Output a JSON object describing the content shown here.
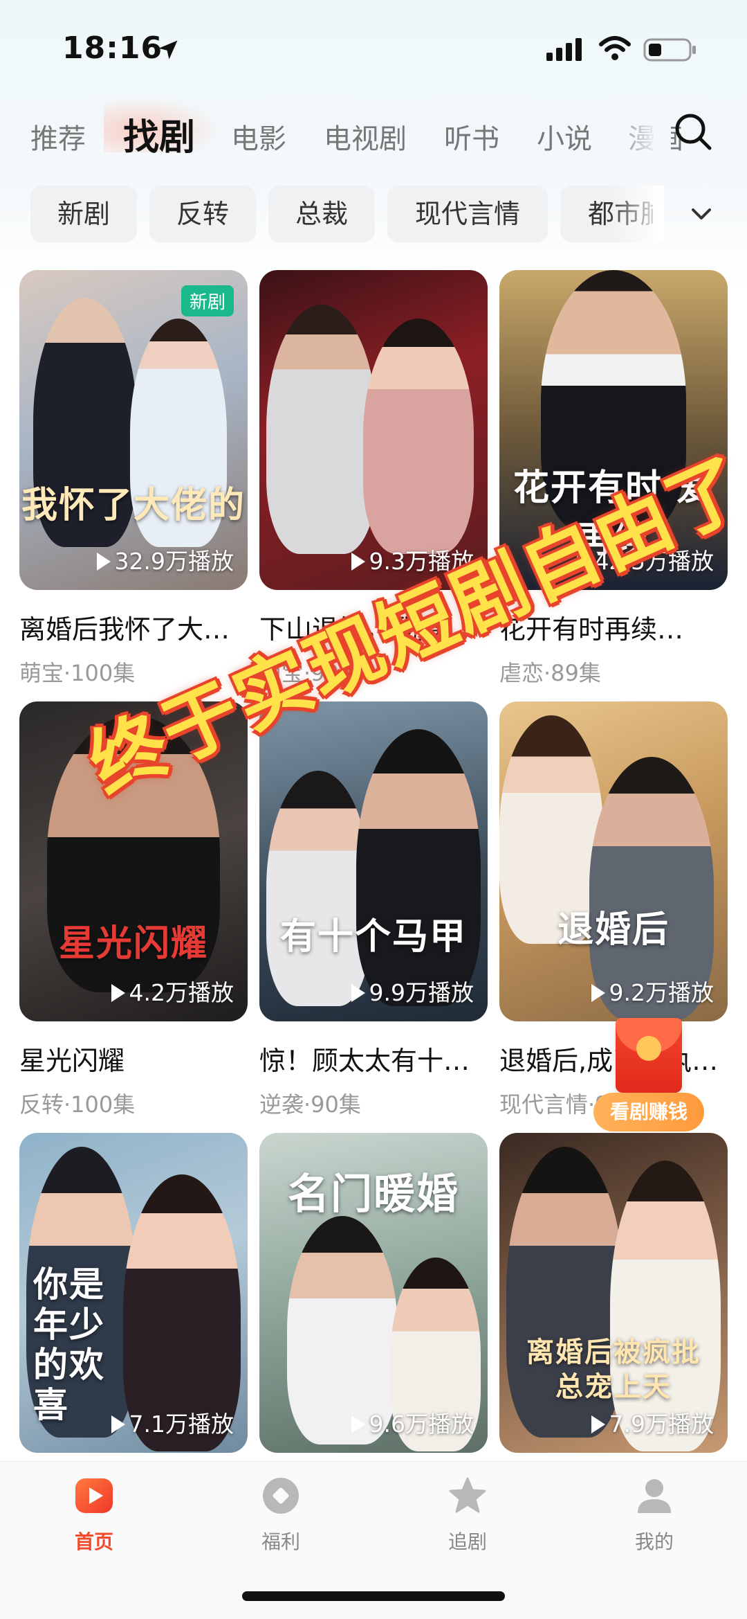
{
  "status_bar": {
    "time": "18:16"
  },
  "top_tabs": [
    {
      "label": "推荐",
      "active": false
    },
    {
      "label": "找剧",
      "active": true
    },
    {
      "label": "电影",
      "active": false
    },
    {
      "label": "电视剧",
      "active": false
    },
    {
      "label": "听书",
      "active": false
    },
    {
      "label": "小说",
      "active": false
    },
    {
      "label": "漫画",
      "active": false
    }
  ],
  "chips": [
    "新剧",
    "反转",
    "总裁",
    "现代言情",
    "都市脑洞"
  ],
  "badge_new": "新剧",
  "cards": [
    {
      "title": "离婚后我怀了大…",
      "meta": "萌宝·100集",
      "plays": "32.9万播放",
      "poster_text": "我怀了大佬的"
    },
    {
      "title": "下山退婚，我竟…",
      "meta": "萌宝·90集",
      "plays": "9.3万播放",
      "poster_text": ""
    },
    {
      "title": "花开有时再续…",
      "meta": "虐恋·89集",
      "plays": "42.5万播放",
      "poster_text": "花开有时 爱再续"
    },
    {
      "title": "星光闪耀",
      "meta": "反转·100集",
      "plays": "4.2万播放",
      "poster_text": "星光闪耀"
    },
    {
      "title": "惊！顾太太有十…",
      "meta": "逆袭·90集",
      "plays": "9.9万播放",
      "poster_text": "有十个马甲"
    },
    {
      "title": "退婚后,成了偏执…",
      "meta": "现代言情·98集",
      "plays": "9.2万播放",
      "poster_text": "退婚后"
    },
    {
      "title": "",
      "meta": "",
      "plays": "7.1万播放",
      "poster_text": "你是年少的欢喜"
    },
    {
      "title": "",
      "meta": "",
      "plays": "9.6万播放",
      "poster_text": "名门暖婚"
    },
    {
      "title": "",
      "meta": "",
      "plays": "7.9万播放",
      "poster_text": "离婚后被疯批总宠上天"
    }
  ],
  "promo_overlay": "终于实现短剧自由了",
  "earn_button": "看剧赚钱",
  "bottom_nav": [
    {
      "label": "首页",
      "icon": "home-play-icon",
      "active": true
    },
    {
      "label": "福利",
      "icon": "welfare-icon",
      "active": false
    },
    {
      "label": "追剧",
      "icon": "star-icon",
      "active": false
    },
    {
      "label": "我的",
      "icon": "profile-icon",
      "active": false
    }
  ],
  "colors": {
    "accent": "#f04a2a",
    "badge_green": "#19b98c",
    "promo_yellow": "#ffe14a",
    "promo_red": "#e8442c"
  }
}
